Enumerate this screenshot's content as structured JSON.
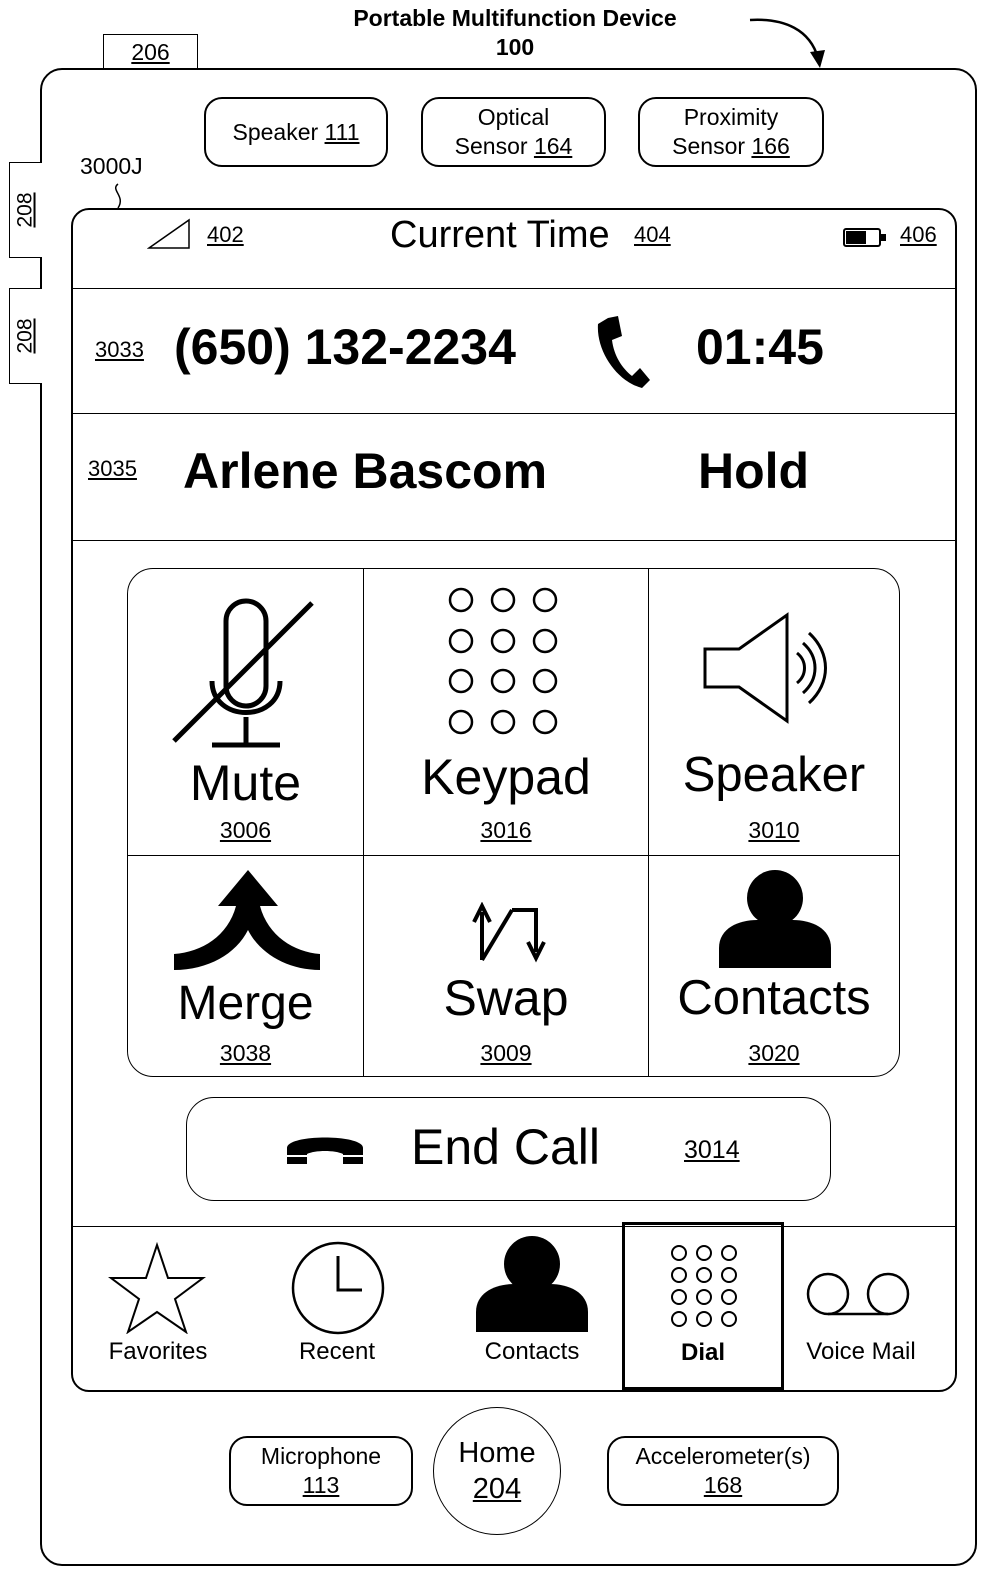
{
  "figure": {
    "title_line1": "Portable Multifunction Device",
    "title_line2": "100",
    "ref_206": "206",
    "ref_208a": "208",
    "ref_208b": "208",
    "screen_ref": "3000J"
  },
  "hardware_top": {
    "speaker": {
      "text": "Speaker ",
      "ref": "111"
    },
    "optical": {
      "line1": "Optical",
      "text": "Sensor ",
      "ref": "164"
    },
    "proximity": {
      "line1": "Proximity",
      "text": "Sensor ",
      "ref": "166"
    }
  },
  "status_bar": {
    "signal_ref": "402",
    "time_label": "Current Time",
    "time_ref": "404",
    "battery_ref": "406"
  },
  "call": {
    "row1_ref": "3033",
    "phone_number": "(650) 132-2234",
    "duration": "01:45",
    "row2_ref": "3035",
    "contact_name": "Arlene Bascom",
    "status": "Hold"
  },
  "buttons": [
    {
      "label": "Mute",
      "ref": "3006",
      "icon": "muted-microphone-icon"
    },
    {
      "label": "Keypad",
      "ref": "3016",
      "icon": "keypad-icon"
    },
    {
      "label": "Speaker",
      "ref": "3010",
      "icon": "speaker-icon"
    },
    {
      "label": "Merge",
      "ref": "3038",
      "icon": "merge-arrow-icon"
    },
    {
      "label": "Swap",
      "ref": "3009",
      "icon": "swap-arrows-icon"
    },
    {
      "label": "Contacts",
      "ref": "3020",
      "icon": "person-icon"
    }
  ],
  "end_call": {
    "label": "End Call",
    "ref": "3014"
  },
  "tabs": [
    {
      "label": "Favorites",
      "icon": "star-icon"
    },
    {
      "label": "Recent",
      "icon": "clock-icon"
    },
    {
      "label": "Contacts",
      "icon": "person-icon"
    },
    {
      "label": "Dial",
      "icon": "keypad-icon",
      "selected": true
    },
    {
      "label": "Voice Mail",
      "icon": "voicemail-icon"
    }
  ],
  "hardware_bottom": {
    "microphone": {
      "label": "Microphone",
      "ref": "113"
    },
    "home": {
      "label": "Home",
      "ref": "204"
    },
    "accelerometer": {
      "label": "Accelerometer(s)",
      "ref": "168"
    }
  }
}
